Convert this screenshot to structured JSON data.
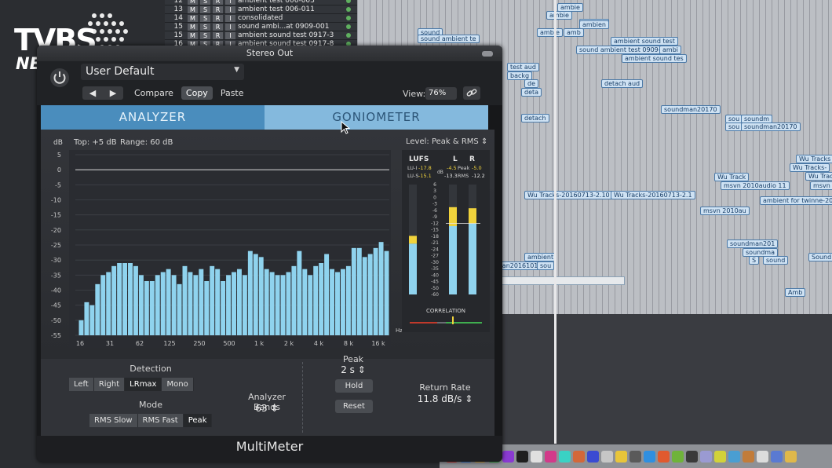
{
  "daw": {
    "tracks": [
      {
        "num": "12",
        "name": "ambient test 006-003"
      },
      {
        "num": "13",
        "name": "ambient test 006-011"
      },
      {
        "num": "14",
        "name": "consolidated"
      },
      {
        "num": "15",
        "name": "sound ambi...at 0909-001"
      },
      {
        "num": "15",
        "name": "ambient sound test 0917-3"
      },
      {
        "num": "16",
        "name": "ambient sound test 0917-8"
      }
    ],
    "track_buttons": [
      "M",
      "S",
      "R",
      "I"
    ],
    "regions": [
      "ambie",
      "ambie",
      "ambien",
      "ambie",
      "amb",
      "ambien",
      "sound",
      "sound ambient te",
      "ambient sound test",
      "sound ambient test 0909-001",
      "ambi",
      "ambient sound tes",
      "test aud",
      "backg",
      "de",
      "deta",
      "detach aud",
      "detach",
      "soundman20170",
      "sou",
      "soundm",
      "sou",
      "soundman20170",
      "Wu Tracks",
      "Wu Tracks-",
      "Wu Track",
      "Wu Track",
      "msvn 2010audio 11",
      "msvn 2",
      "Wu Tracks-20160713-2.10",
      "Wu Tracks-20160713-2.1",
      "msvn 2010au",
      "ambient for twinne-2016",
      "soundman201",
      "soundma",
      "S",
      "sound",
      "Sound",
      "ambient",
      "man20161018-1",
      "sou",
      "Amb"
    ]
  },
  "watermark": {
    "logo": "TVBS",
    "sub": "NEWS"
  },
  "plugin": {
    "window_title": "Stereo Out",
    "preset": "User Default",
    "header_buttons": {
      "compare": "Compare",
      "copy": "Copy",
      "paste": "Paste"
    },
    "nav": {
      "prev": "◀",
      "next": "▶"
    },
    "view_label": "View:",
    "view_value": "76%",
    "tabs": {
      "analyzer": "ANALYZER",
      "goniometer": "GONIOMETER"
    },
    "analyzer": {
      "db_unit": "dB",
      "top_label": "Top: +5 dB",
      "range_label": "Range: 60 dB",
      "hz_unit": "Hz"
    },
    "level": {
      "label": "Level: Peak & RMS ⇕",
      "lufs_header": "LUFS",
      "l_header": "L",
      "r_header": "R",
      "lui_label": "LU-I",
      "lui_value": "-17.8",
      "lus_label": "LU-S",
      "lus_value": "-15.1",
      "db_unit": "dB",
      "peak_label": "Peak",
      "rms_label": "RMS",
      "peak_l": "-4.5",
      "peak_r": "-5.0",
      "rms_l": "-13.3",
      "rms_r": "-12.2",
      "correlation_label": "CORRELATION"
    },
    "controls": {
      "detection_label": "Detection",
      "detection_options": [
        "Left",
        "Right",
        "LRmax",
        "Mono"
      ],
      "detection_selected": "LRmax",
      "mode_label": "Mode",
      "mode_options": [
        "RMS Slow",
        "RMS Fast",
        "Peak"
      ],
      "mode_selected": "Peak",
      "bands_label": "Analyzer Bands",
      "bands_value": "63 ⇕",
      "peak_label": "Peak",
      "peak_value": "2 s ⇕",
      "hold_button": "Hold",
      "reset_button": "Reset",
      "return_rate_label": "Return Rate",
      "return_rate_value": "11.8 dB/s ⇕"
    },
    "footer_name": "MultiMeter"
  },
  "colors": {
    "accent": "#4a8dbd",
    "accent_light": "#84b9dd",
    "bar": "#8fd3ee",
    "meter_yellow": "#f0d33c"
  },
  "chart_data": {
    "type": "bar",
    "title": "",
    "y_ticks": [
      "5",
      "0",
      "-5",
      "-10",
      "-15",
      "-20",
      "-25",
      "-30",
      "-35",
      "-40",
      "-45",
      "-50",
      "-55"
    ],
    "ylim": [
      -55,
      5
    ],
    "x_ticks": [
      "16",
      "31",
      "62",
      "125",
      "250",
      "500",
      "1 k",
      "2 k",
      "4 k",
      "8 k",
      "16 k"
    ],
    "values": [
      -50,
      -44,
      -45,
      -38,
      -35,
      -34,
      -32,
      -31,
      -31,
      -31,
      -32,
      -35,
      -37,
      -37,
      -35,
      -34,
      -33,
      -35,
      -38,
      -32,
      -34,
      -35,
      -33,
      -37,
      -32,
      -33,
      -37,
      -35,
      -34,
      -33,
      -35,
      -27,
      -28,
      -29,
      -33,
      -34,
      -35,
      -35,
      -34,
      -32,
      -27,
      -33,
      -35,
      -32,
      -31,
      -28,
      -33,
      -34,
      -33,
      -32,
      -26,
      -26,
      -29,
      -28,
      -26,
      -24,
      -27
    ],
    "meter": {
      "lufs_scale": [
        "6",
        "3",
        "0",
        "-3",
        "-6",
        "-9",
        "-12",
        "-15",
        "-18",
        "-21",
        "-24",
        "-27",
        "-30",
        "-35",
        "-40",
        "-45",
        "-50",
        "-60"
      ],
      "lufs_level": -17.8,
      "peak_l": -4.5,
      "peak_r": -5.0,
      "rms_l": -13.3,
      "rms_r": -12.2
    }
  }
}
